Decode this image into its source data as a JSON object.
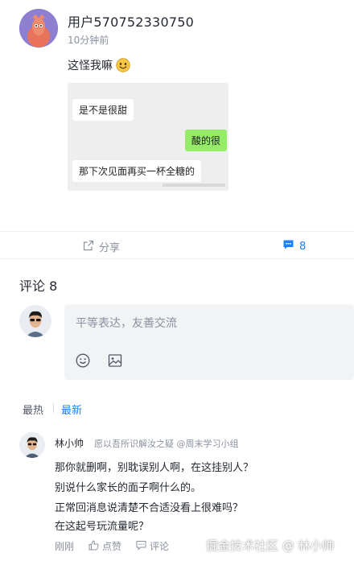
{
  "post": {
    "username": "用户570752330750",
    "time": "10分钟前",
    "text": "这怪我嘛",
    "emoji_icon": "smile-emoji-icon",
    "image": {
      "bubble1": "是不是很甜",
      "bubble2": "酸的很",
      "bubble3": "那下次见面再买一杯全糖的",
      "bubble_right_color": "#95ec69"
    }
  },
  "actions": {
    "share_label": "分享",
    "comment_count": "8",
    "accent_color": "#1e80ff"
  },
  "comments_section": {
    "title": "评论 8",
    "input_placeholder": "平等表达，友善交流",
    "sort_hot": "热",
    "sort_hot_prefix": "最",
    "sort_new": "最新"
  },
  "comment": {
    "author": "林小帅",
    "meta": "愿以吾所识解汝之疑 @周末学习小组",
    "lines": [
      "那你就删啊，别耽误别人啊，在这挂别人？",
      "别说什么家长的面子啊什么的。",
      "正常回消息说清楚不合适没看上很难吗？",
      "在这起号玩流量呢？"
    ],
    "time": "刚刚",
    "like_label": "点赞",
    "reply_label": "评论"
  },
  "watermark": "掘金技术社区 @ 林小帅"
}
